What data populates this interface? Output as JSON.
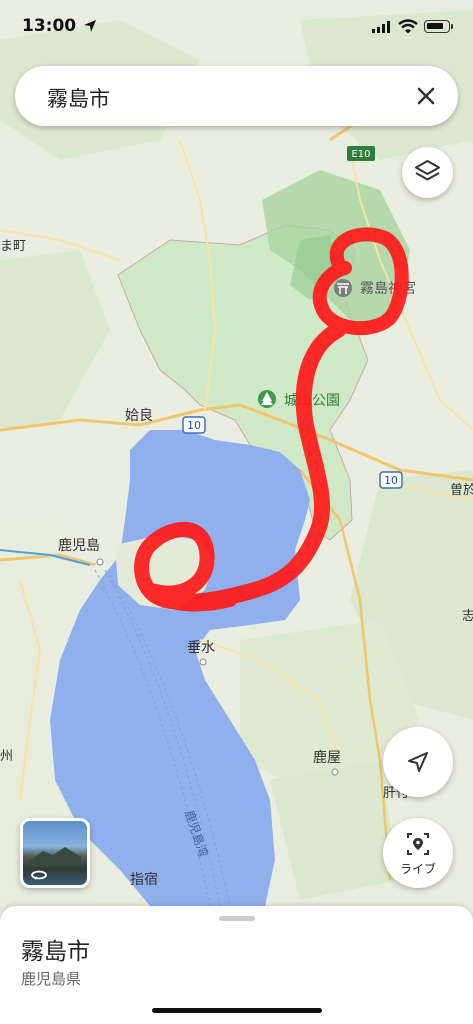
{
  "status": {
    "time": "13:00"
  },
  "search": {
    "query": "霧島市"
  },
  "map": {
    "labels": {
      "kirishima_shrine": "霧島神宮",
      "jouyama_park": "城山公園",
      "aira": "姶良",
      "kagoshima": "鹿児島",
      "tarumizu": "垂水",
      "kanoya": "鹿屋",
      "ibusuki": "指宿",
      "soo": "曽於",
      "kimotsuki": "肝付",
      "shibushi": "志",
      "bay": "鹿児島湾",
      "left_town": "ま町",
      "left_edge": "州",
      "route_10a": "10",
      "route_10b": "10",
      "expressway": "E10"
    }
  },
  "controls": {
    "live_label": "ライブ"
  },
  "sheet": {
    "title": "霧島市",
    "subtitle": "鹿児島県"
  },
  "colors": {
    "water": "#8fb0ec",
    "land": "#e7ecde",
    "city_area": "#cfe8c6",
    "highlight": "#ff1a1a"
  }
}
